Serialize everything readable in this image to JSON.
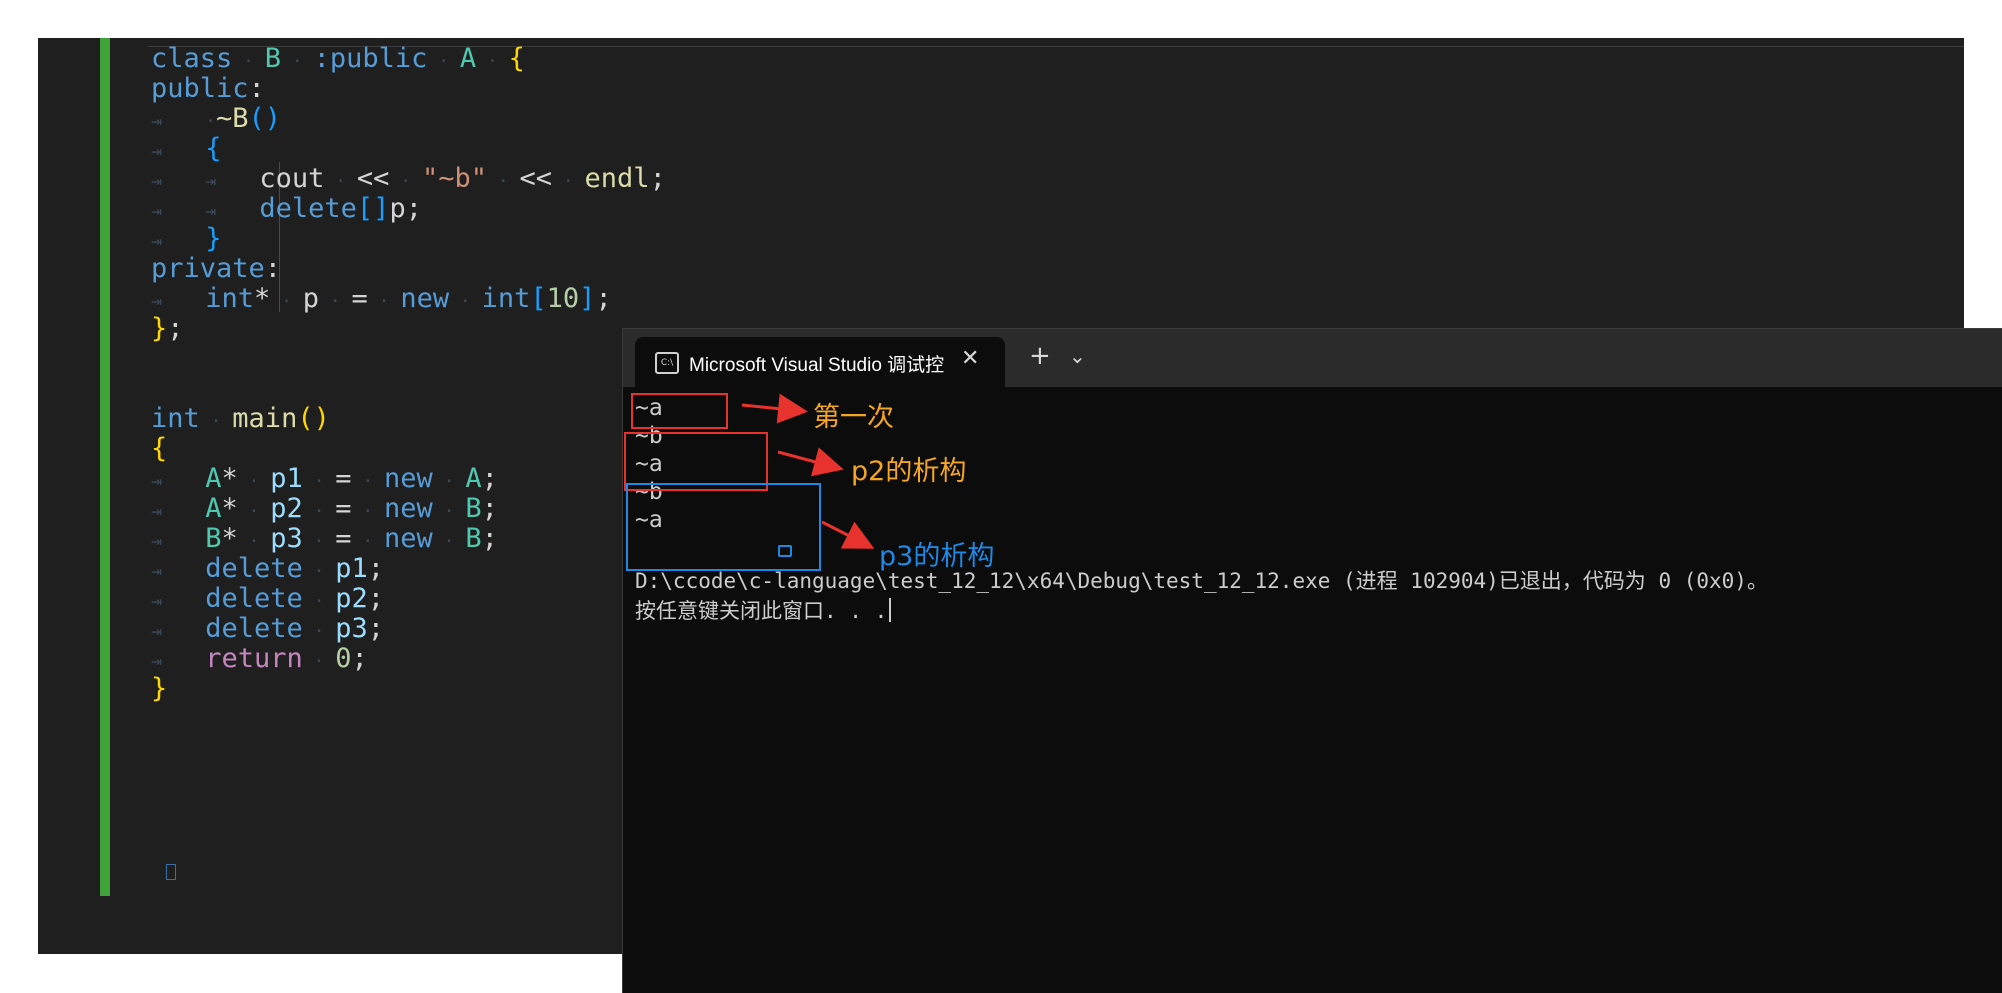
{
  "editor": {
    "code": {
      "l1": {
        "class_kw": "class",
        "b": "B",
        "colon_public": ":public",
        "a": "A",
        "brace": "{"
      },
      "l2": {
        "public": "public",
        "colon": ":"
      },
      "l3": {
        "tilde_b": "~B",
        "parens": "()"
      },
      "l4": {
        "brace": "{"
      },
      "l5": {
        "cout": "cout",
        "op1": "<<",
        "str": "\"~b\"",
        "op2": "<<",
        "endl": "endl",
        "semi": ";"
      },
      "l6": {
        "delete": "delete",
        "brackets": "[]",
        "p": "p",
        "semi": ";"
      },
      "l7": {
        "brace": "}"
      },
      "l8": {
        "private": "private",
        "colon": ":"
      },
      "l9": {
        "int": "int",
        "star": "*",
        "p": "p",
        "eq": "=",
        "new": "new",
        "int2": "int",
        "lb": "[",
        "num": "10",
        "rb": "]",
        "semi": ";"
      },
      "l10": {
        "brace": "}",
        "semi": ";"
      },
      "l11": {
        "int": "int",
        "main": "main",
        "parens": "()"
      },
      "l12": {
        "brace": "{"
      },
      "l13": {
        "type": "A",
        "star": "*",
        "var": "p1",
        "eq": "=",
        "new": "new",
        "ctor": "A",
        "semi": ";"
      },
      "l14": {
        "type": "A",
        "star": "*",
        "var": "p2",
        "eq": "=",
        "new": "new",
        "ctor": "B",
        "semi": ";"
      },
      "l15": {
        "type": "B",
        "star": "*",
        "var": "p3",
        "eq": "=",
        "new": "new",
        "ctor": "B",
        "semi": ";"
      },
      "l16": {
        "delete": "delete",
        "var": "p1",
        "semi": ";"
      },
      "l17": {
        "delete": "delete",
        "var": "p2",
        "semi": ";"
      },
      "l18": {
        "delete": "delete",
        "var": "p3",
        "semi": ";"
      },
      "l19": {
        "ret": "return",
        "num": "0",
        "semi": ";"
      },
      "l20": {
        "brace": "}"
      }
    }
  },
  "console": {
    "tab_title": "Microsoft Visual Studio 调试控",
    "tab_icon": "C:\\",
    "close_glyph": "✕",
    "new_tab_glyph": "+",
    "dropdown_glyph": "⌄",
    "output": [
      "~a",
      "~b",
      "~a",
      "~b",
      "~a",
      "D:\\ccode\\c-language\\test_12_12\\x64\\Debug\\test_12_12.exe (进程 102904)已退出，代码为 0 (0x0)。",
      "按任意键关闭此窗口. . ."
    ]
  },
  "annotations": {
    "first": "第一次",
    "p2": "p2的析构",
    "p3": "p3的析构",
    "colors": {
      "red": "#e8322d",
      "orange": "#f5a623",
      "blue": "#1e88e5"
    }
  },
  "colors": {
    "gutter_bar": "#3fa33a",
    "editor_bg": "#1f1f1f",
    "console_bg": "#0c0c0c"
  }
}
